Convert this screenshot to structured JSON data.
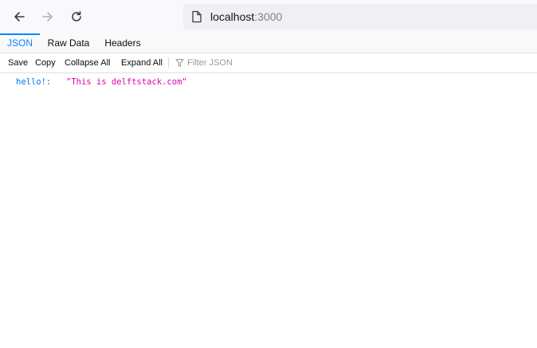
{
  "browser": {
    "url_host": "localhost",
    "url_port": ":3000",
    "icons": [
      "back-arrow-icon",
      "forward-arrow-icon",
      "reload-icon",
      "page-icon"
    ]
  },
  "viewer": {
    "tabs": [
      {
        "label": "JSON",
        "selected": true
      },
      {
        "label": "Raw Data",
        "selected": false
      },
      {
        "label": "Headers",
        "selected": false
      }
    ],
    "toolbar": {
      "save_label": "Save",
      "copy_label": "Copy",
      "collapse_label": "Collapse All",
      "expand_label": "Expand All",
      "filter_placeholder": "Filter JSON",
      "filter_icon": "filter-icon"
    },
    "rows": [
      {
        "key": "hello!:",
        "value": "\"This is delftstack.com\""
      }
    ]
  },
  "colors": {
    "accent": "#0a84ff",
    "json_key": "#0074e8",
    "json_string": "#dd00a9"
  }
}
